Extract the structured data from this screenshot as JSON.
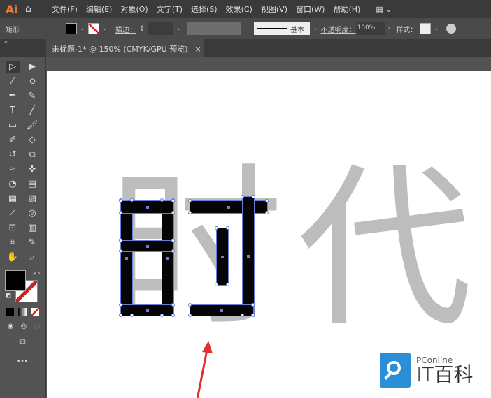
{
  "app": {
    "logo": "Ai"
  },
  "menu": [
    "文件(F)",
    "编辑(E)",
    "对象(O)",
    "文字(T)",
    "选择(S)",
    "效果(C)",
    "视图(V)",
    "窗口(W)",
    "帮助(H)"
  ],
  "control": {
    "object_type": "矩形",
    "stroke_label": "描边：",
    "stroke_profile": "基本",
    "opacity_label": "不透明度：",
    "opacity_value": "100%",
    "style_label": "样式："
  },
  "tab": {
    "title": "未标题-1* @ 150% (CMYK/GPU 预览)",
    "close": "×"
  },
  "canvas": {
    "artwork_text": "时代"
  },
  "watermark": {
    "brand": "PConline",
    "name": "IT百科"
  },
  "toolbar": {
    "more": "•••"
  },
  "colors": {
    "fill": "#000000",
    "accent": "#e07b39",
    "selection": "#6c7fd8",
    "arrow": "#e03030"
  }
}
